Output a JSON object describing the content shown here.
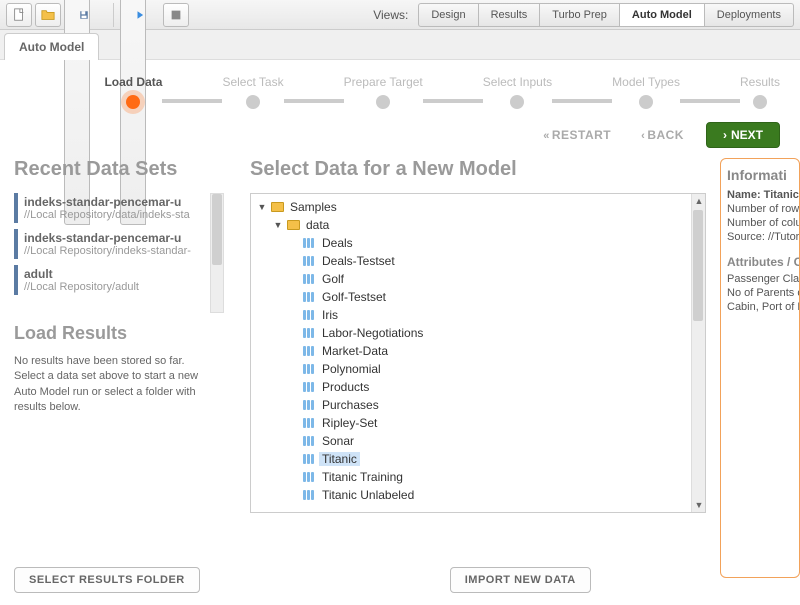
{
  "toolbar": {
    "views_label": "Views:",
    "tabs": [
      "Design",
      "Results",
      "Turbo Prep",
      "Auto Model",
      "Deployments"
    ],
    "active_tab": "Auto Model"
  },
  "subtab": {
    "label": "Auto Model"
  },
  "stepper": {
    "steps": [
      "Load Data",
      "Select Task",
      "Prepare Target",
      "Select Inputs",
      "Model Types",
      "Results"
    ],
    "active_index": 0,
    "restart": "RESTART",
    "back": "BACK",
    "next": "NEXT"
  },
  "left": {
    "recent_title": "Recent Data Sets",
    "recent": [
      {
        "name": "indeks-standar-pencemar-u",
        "path": "//Local Repository/data/indeks-sta"
      },
      {
        "name": "indeks-standar-pencemar-u",
        "path": "//Local Repository/indeks-standar-"
      },
      {
        "name": "adult",
        "path": "//Local Repository/adult"
      }
    ],
    "load_results_title": "Load Results",
    "load_results_text": "No results have been stored so far. Select a data set above to start a new Auto Model run or select a folder with results below.",
    "select_folder_btn": "SELECT RESULTS FOLDER"
  },
  "mid": {
    "title": "Select Data for a New Model",
    "import_btn": "IMPORT NEW DATA",
    "tree_root": "Samples",
    "tree_sub": "data",
    "datasets": [
      "Deals",
      "Deals-Testset",
      "Golf",
      "Golf-Testset",
      "Iris",
      "Labor-Negotiations",
      "Market-Data",
      "Polynomial",
      "Products",
      "Purchases",
      "Ripley-Set",
      "Sonar",
      "Titanic",
      "Titanic Training",
      "Titanic Unlabeled"
    ],
    "selected": "Titanic"
  },
  "info": {
    "heading": "Informati",
    "rows": [
      "Name: Titanic",
      "Number of rows",
      "Number of colum",
      "Source: //Tutori"
    ],
    "sub_heading": "Attributes / C",
    "attrs": [
      "Passenger Class",
      "No of Parents or",
      "Cabin, Port of Em"
    ]
  }
}
